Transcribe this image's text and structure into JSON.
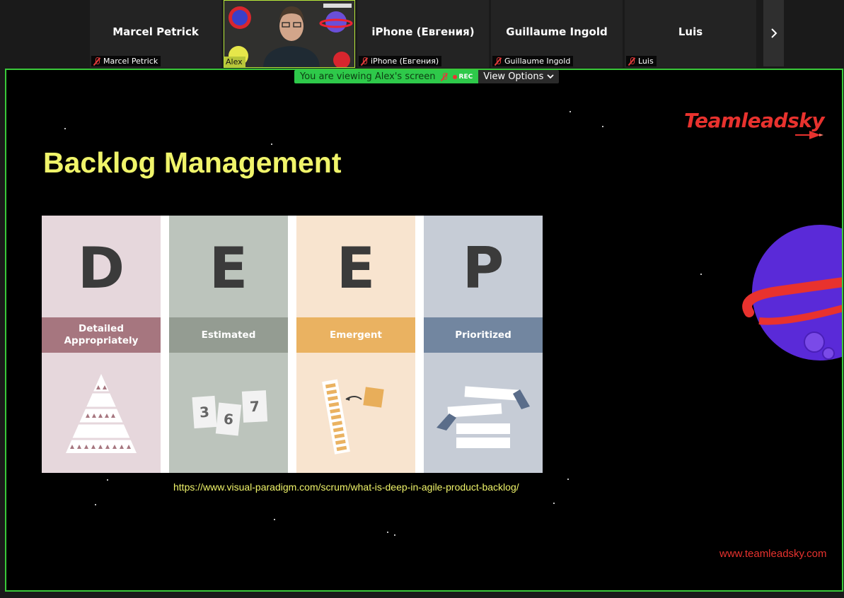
{
  "participants": [
    {
      "name": "Marcel Petrick",
      "tag": "Marcel Petrick"
    },
    {
      "name": "Alex",
      "tag": "Alex"
    },
    {
      "name": "iPhone (Евгения)",
      "tag": "iPhone (Евгения)"
    },
    {
      "name": "Guillaume Ingold",
      "tag": "Guillaume Ingold"
    },
    {
      "name": "Luis",
      "tag": "Luis"
    }
  ],
  "banner": {
    "viewing": "You are viewing Alex's screen",
    "rec": "REC",
    "view_options": "View Options"
  },
  "slide": {
    "title": "Backlog Management",
    "brand": "Teamleadsky",
    "columns": [
      {
        "letter": "D",
        "label": "Detailed Appropriately"
      },
      {
        "letter": "E",
        "label": "Estimated"
      },
      {
        "letter": "E",
        "label": "Emergent"
      },
      {
        "letter": "P",
        "label": "Prioritized"
      }
    ],
    "estimate_cards": [
      "3",
      "6",
      "7"
    ],
    "source_link": "https://www.visual-paradigm.com/scrum/what-is-deep-in-agile-product-backlog/",
    "website": "www.teamleadsky.com"
  },
  "colors": {
    "accent_green": "#3ac93a",
    "title_yellow": "#f0f46a",
    "brand_red": "#e8322e"
  }
}
